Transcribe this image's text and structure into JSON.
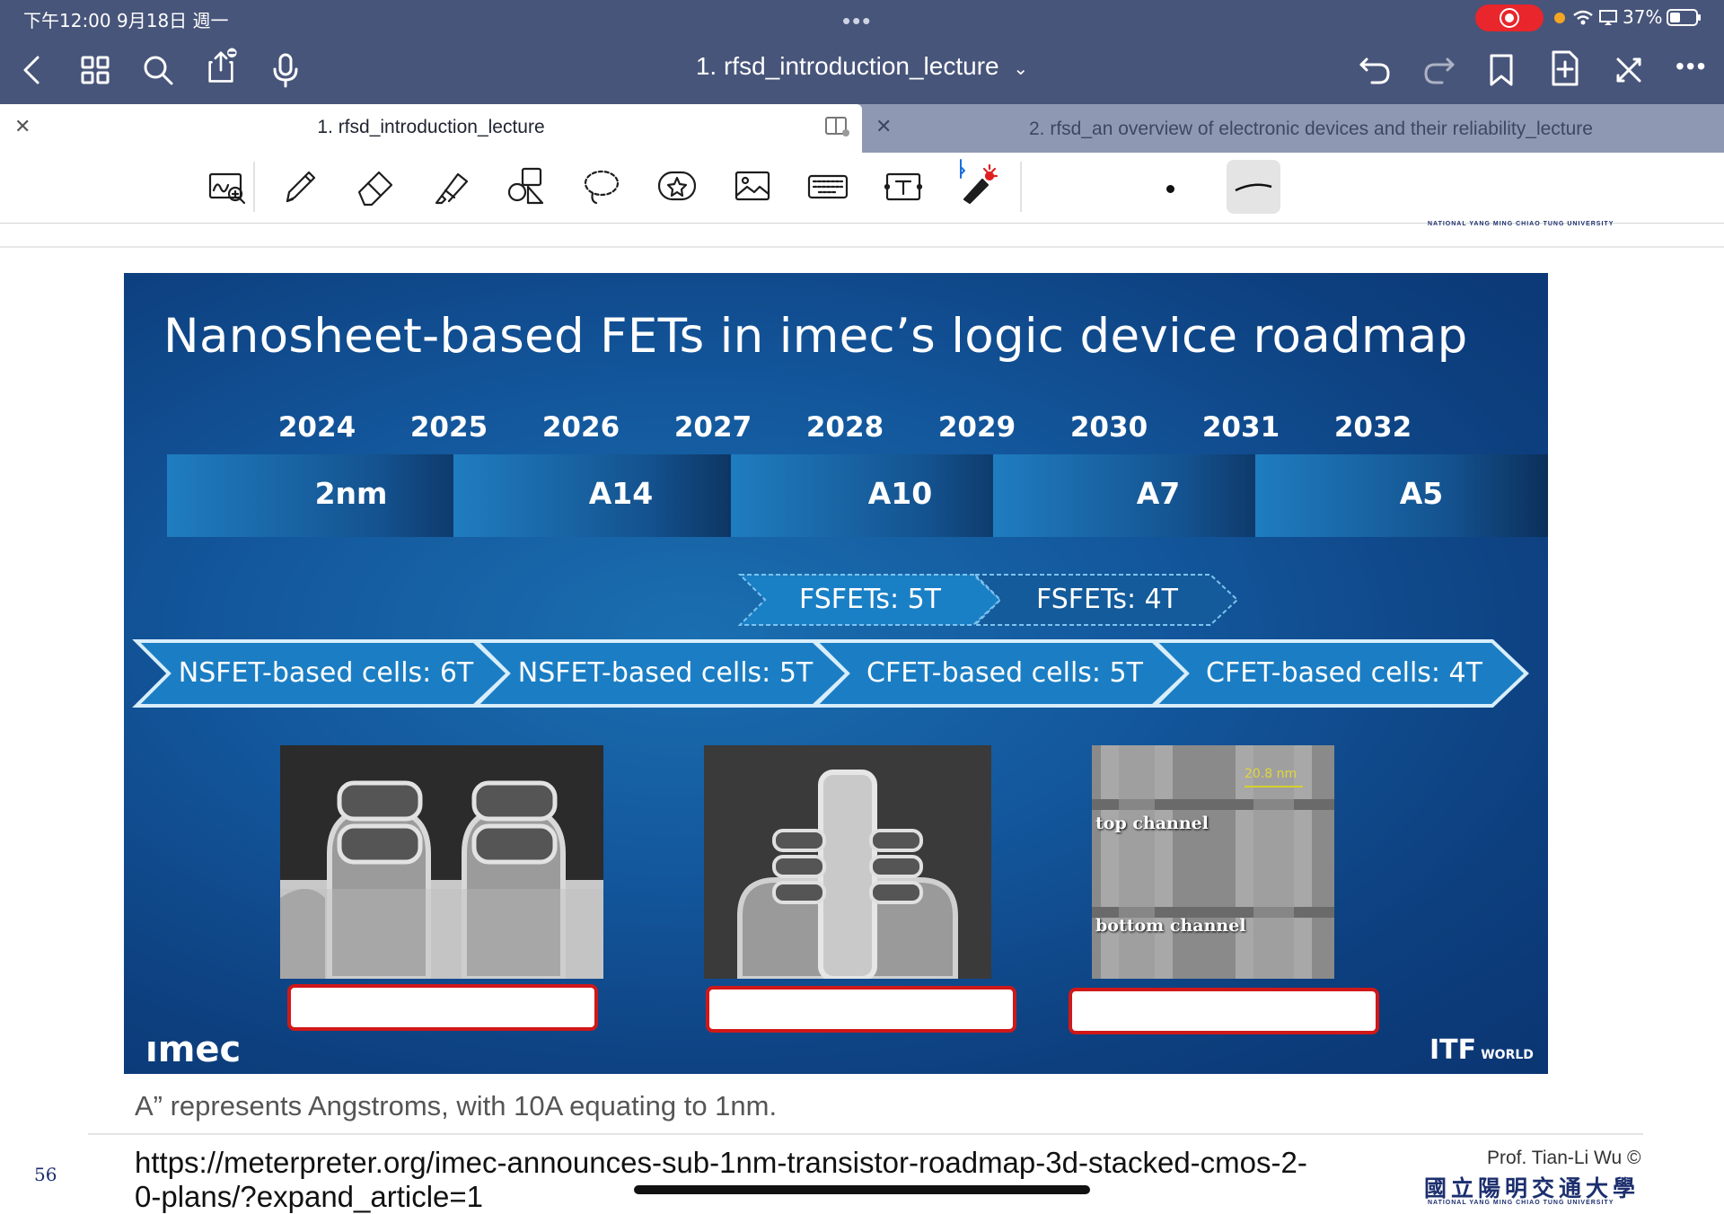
{
  "status": {
    "time_date": "下午12:00  9月18日 週一",
    "battery": "37%"
  },
  "nav": {
    "doc_title": "1. rfsd_introduction_lecture",
    "dropdown": "⌄"
  },
  "tabs": [
    {
      "label": "1. rfsd_introduction_lecture",
      "active": true
    },
    {
      "label": "2. rfsd_an overview of electronic devices and their reliability_lecture",
      "active": false
    }
  ],
  "header_strip": "NATIONAL  YANG  MING  CHIAO  TUNG  UNIVERSITY",
  "slide": {
    "title": "Nanosheet-based FETs in imec’s logic device roadmap",
    "years": [
      "2024",
      "2025",
      "2026",
      "2027",
      "2028",
      "2029",
      "2030",
      "2031",
      "2032"
    ],
    "nodes": [
      "2nm",
      "A14",
      "A10",
      "A7",
      "A5"
    ],
    "fsfet": [
      "FSFETs: 5T",
      "FSFETs: 4T"
    ],
    "cells": [
      "NSFET-based cells: 6T",
      "NSFET-based cells: 5T",
      "CFET-based cells: 5T",
      "CFET-based cells: 4T"
    ],
    "tem_labels": {
      "scale": "20.8 nm",
      "top": "top channel",
      "bottom": "bottom channel"
    },
    "logo_left": "ımec",
    "logo_right_main": "ITF",
    "logo_right_sub": "WORLD"
  },
  "footnote": "A” represents Angstroms, with 10A equating to 1nm.",
  "page_number": "56",
  "url_line1": "https://meterpreter.org/imec-announces-sub-1nm-transistor-roadmap-3d-stacked-cmos-2-",
  "url_line2": "0-plans/?expand_article=1",
  "credit": "Prof. Tian-Li Wu ©",
  "university_cn": "國立陽明交通大學",
  "university_en": "NATIONAL  YANG  MING  CHIAO  TUNG  UNIVERSITY"
}
